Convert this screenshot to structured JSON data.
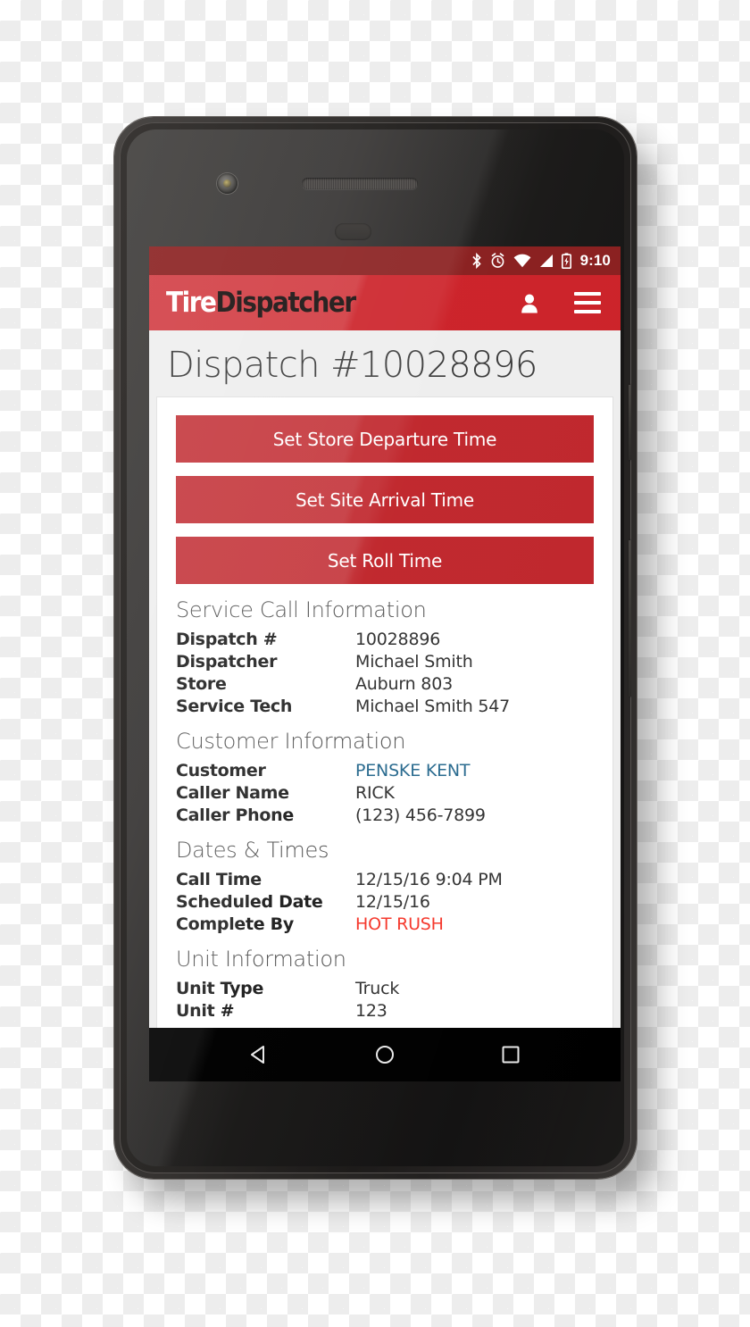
{
  "statusbar": {
    "time": "9:10",
    "icons": [
      "bluetooth-icon",
      "alarm-icon",
      "wifi-icon",
      "cellular-signal-icon",
      "battery-charging-icon"
    ]
  },
  "appbar": {
    "logo_part1": "Tire",
    "logo_part2": "Dispatcher",
    "account_icon": "person-icon",
    "menu_icon": "hamburger-menu-icon"
  },
  "page": {
    "title": "Dispatch #10028896"
  },
  "actions": [
    {
      "label": "Set Store Departure Time"
    },
    {
      "label": "Set Site Arrival Time"
    },
    {
      "label": "Set Roll Time"
    }
  ],
  "sections": [
    {
      "title": "Service Call Information",
      "rows": [
        {
          "key": "Dispatch #",
          "value": "10028896",
          "style": "plain"
        },
        {
          "key": "Dispatcher",
          "value": "Michael Smith",
          "style": "plain"
        },
        {
          "key": "Store",
          "value": "Auburn 803",
          "style": "plain"
        },
        {
          "key": "Service Tech",
          "value": "Michael Smith 547",
          "style": "plain"
        }
      ]
    },
    {
      "title": "Customer Information",
      "rows": [
        {
          "key": "Customer",
          "value": "PENSKE KENT",
          "style": "link"
        },
        {
          "key": "Caller Name",
          "value": "RICK",
          "style": "plain"
        },
        {
          "key": "Caller Phone",
          "value": "(123) 456-7899",
          "style": "plain"
        }
      ]
    },
    {
      "title": "Dates & Times",
      "rows": [
        {
          "key": "Call Time",
          "value": "12/15/16 9:04 PM",
          "style": "plain"
        },
        {
          "key": "Scheduled Date",
          "value": "12/15/16",
          "style": "plain"
        },
        {
          "key": "Complete By",
          "value": "HOT RUSH",
          "style": "alert"
        }
      ]
    },
    {
      "title": "Unit Information",
      "rows": [
        {
          "key": "Unit Type",
          "value": "Truck",
          "style": "plain"
        },
        {
          "key": "Unit #",
          "value": "123",
          "style": "plain"
        }
      ]
    }
  ],
  "navbar": {
    "back": "back-triangle-icon",
    "home": "home-circle-icon",
    "recents": "recents-square-icon"
  },
  "colors": {
    "brand_red": "#cc2229",
    "button_red": "#c0272d",
    "statusbar_red": "#8a1f1f",
    "link_blue": "#2a6b8f",
    "alert_red": "#f5382c",
    "page_bg": "#eeeeee"
  }
}
